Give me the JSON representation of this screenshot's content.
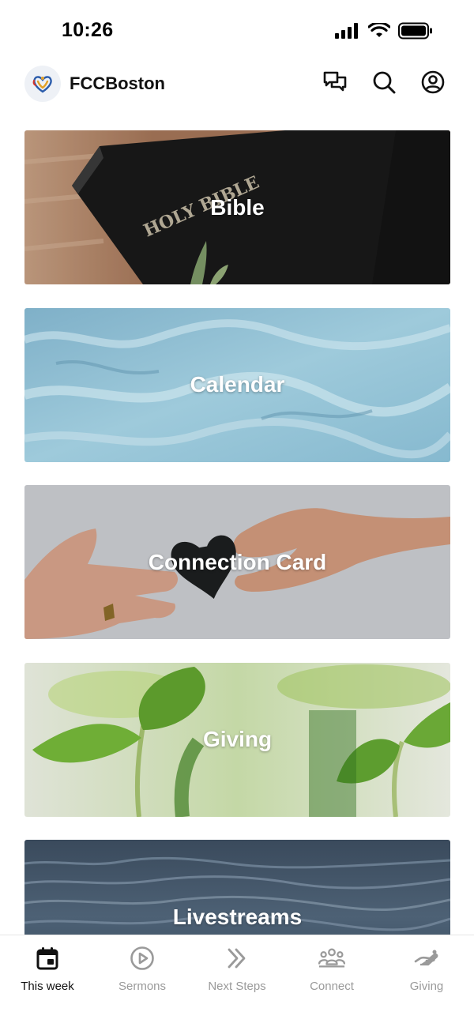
{
  "status_bar": {
    "time": "10:26",
    "icons": [
      "cellular-signal-icon",
      "wifi-icon",
      "battery-icon"
    ]
  },
  "header": {
    "title": "FCCBoston",
    "logo_icon": "church-logo-icon",
    "actions": [
      "chat-icon",
      "search-icon",
      "profile-icon"
    ]
  },
  "cards": [
    {
      "label": "Bible",
      "image": "holy-bible-photo"
    },
    {
      "label": "Calendar",
      "image": "blue-water-photo"
    },
    {
      "label": "Connection Card",
      "image": "hands-heart-photo"
    },
    {
      "label": "Giving",
      "image": "green-sprouts-photo"
    },
    {
      "label": "Livestreams",
      "image": "ocean-waves-photo"
    }
  ],
  "tab_bar": {
    "active": "This week",
    "tabs": [
      {
        "label": "This week",
        "icon": "calendar-icon"
      },
      {
        "label": "Sermons",
        "icon": "play-circle-icon"
      },
      {
        "label": "Next Steps",
        "icon": "double-chevron-right-icon"
      },
      {
        "label": "Connect",
        "icon": "group-icon"
      },
      {
        "label": "Giving",
        "icon": "giving-hand-icon"
      }
    ]
  },
  "colors": {
    "active_tab": "#111111",
    "inactive_tab": "#9a9a9a",
    "card_text": "#ffffff"
  }
}
